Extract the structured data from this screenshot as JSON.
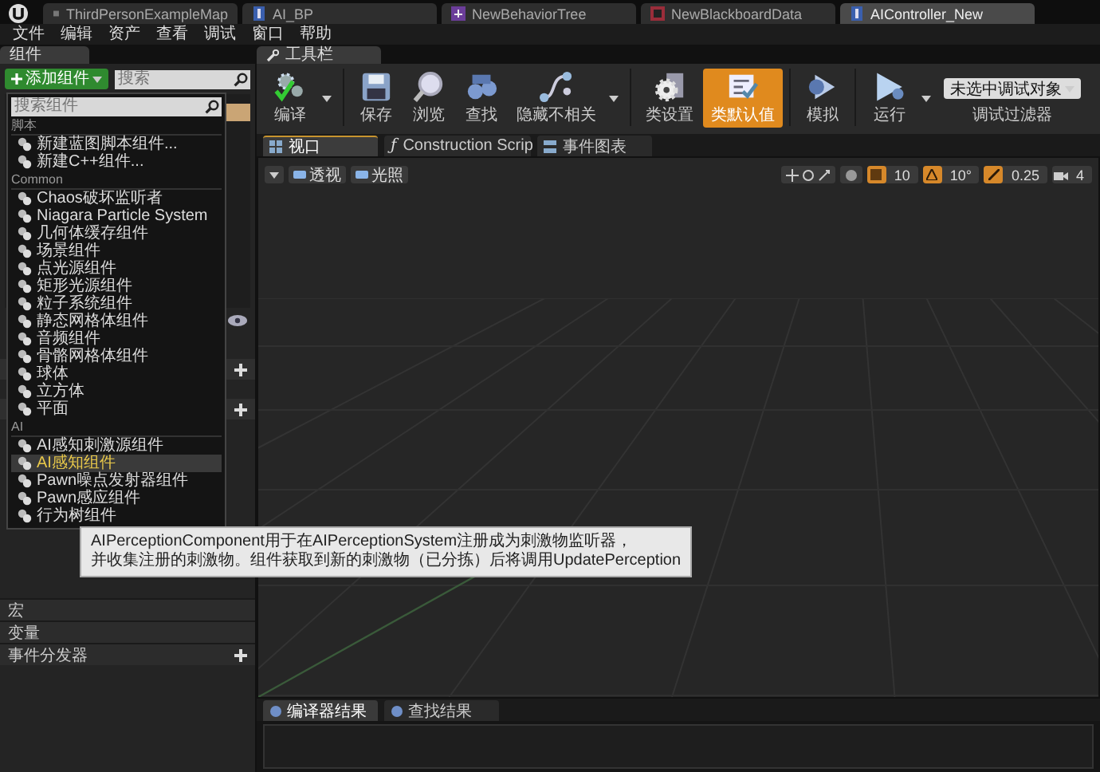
{
  "file_tabs": [
    {
      "label": "ThirdPersonExampleMap",
      "kind": "map",
      "selected": false
    },
    {
      "label": "AI_BP",
      "kind": "blueprint",
      "selected": false
    },
    {
      "label": "NewBehaviorTree",
      "kind": "tree",
      "selected": false
    },
    {
      "label": "NewBlackboardData",
      "kind": "board",
      "selected": false
    },
    {
      "label": "AIController_New",
      "kind": "blueprint",
      "selected": true
    }
  ],
  "menu_bar": [
    "文件",
    "编辑",
    "资产",
    "查看",
    "调试",
    "窗口",
    "帮助"
  ],
  "components_panel": {
    "title": "组件",
    "add_button": "添加组件",
    "search": {
      "placeholder": "搜索"
    }
  },
  "my_blueprint": {
    "sections": [
      {
        "label": "宏",
        "add": false
      },
      {
        "label": "变量",
        "add": false
      },
      {
        "label": "事件分发器",
        "add": true
      }
    ]
  },
  "add_component_menu": {
    "search": {
      "placeholder": "搜索组件"
    },
    "groups": [
      {
        "title": "脚本",
        "items": [
          {
            "label": "新建蓝图脚本组件...",
            "selected": false
          },
          {
            "label": "新建C++组件...",
            "selected": false
          }
        ]
      },
      {
        "title": "Common",
        "items": [
          {
            "label": "Chaos破坏监听者",
            "selected": false
          },
          {
            "label": "Niagara Particle System",
            "selected": false
          },
          {
            "label": "几何体缓存组件",
            "selected": false
          },
          {
            "label": "场景组件",
            "selected": false
          },
          {
            "label": "点光源组件",
            "selected": false
          },
          {
            "label": "矩形光源组件",
            "selected": false
          },
          {
            "label": "粒子系统组件",
            "selected": false
          },
          {
            "label": "静态网格体组件",
            "selected": false
          },
          {
            "label": "音频组件",
            "selected": false
          },
          {
            "label": "骨骼网格体组件",
            "selected": false
          },
          {
            "label": "球体",
            "selected": false
          },
          {
            "label": "立方体",
            "selected": false
          },
          {
            "label": "平面",
            "selected": false
          }
        ]
      },
      {
        "title": "AI",
        "items": [
          {
            "label": "AI感知刺激源组件",
            "selected": false
          },
          {
            "label": "AI感知组件",
            "selected": true
          },
          {
            "label": "Pawn噪点发射器组件",
            "selected": false
          },
          {
            "label": "Pawn感应组件",
            "selected": false
          },
          {
            "label": "行为树组件",
            "selected": false
          }
        ]
      }
    ]
  },
  "tooltip_lines": [
    "AIPerceptionComponent用于在AIPerceptionSystem注册成为刺激物监听器，",
    "并收集注册的刺激物。组件获取到新的刺激物（已分拣）后将调用UpdatePerception"
  ],
  "toolbar": {
    "title": "工具栏",
    "buttons": [
      {
        "label": "编译",
        "kind": "compile",
        "dropdown": true,
        "selected": false
      },
      {
        "label": "保存",
        "kind": "save",
        "dropdown": false,
        "selected": false
      },
      {
        "label": "浏览",
        "kind": "browse",
        "dropdown": false,
        "selected": false
      },
      {
        "label": "查找",
        "kind": "find",
        "dropdown": false,
        "selected": false
      },
      {
        "label": "隐藏不相关",
        "kind": "hide",
        "dropdown": true,
        "selected": false
      },
      {
        "label": "类设置",
        "kind": "settings",
        "dropdown": false,
        "selected": false
      },
      {
        "label": "类默认值",
        "kind": "defaults",
        "dropdown": false,
        "selected": true
      },
      {
        "label": "模拟",
        "kind": "simulate",
        "dropdown": false,
        "selected": false
      },
      {
        "label": "运行",
        "kind": "play",
        "dropdown": true,
        "selected": false
      }
    ],
    "debug_filter": {
      "value": "未选中调试对象",
      "label": "调试过滤器"
    }
  },
  "editor_tabs": [
    {
      "label": "视口",
      "kind": "viewport",
      "selected": true
    },
    {
      "label": "Construction Scrip",
      "kind": "function",
      "icon": "ƒ",
      "selected": false
    },
    {
      "label": "事件图表",
      "kind": "graph",
      "selected": false
    }
  ],
  "viewport": {
    "view_buttons": [
      "透视",
      "光照"
    ],
    "grid_snap": {
      "value": "10",
      "on": true
    },
    "rotation_snap": {
      "value": "10°",
      "on": true
    },
    "scale_snap": {
      "value": "0.25",
      "on": true
    },
    "camera_speed": "4"
  },
  "bottom_tabs": [
    {
      "label": "编译器结果",
      "selected": true
    },
    {
      "label": "查找结果",
      "selected": false
    }
  ]
}
